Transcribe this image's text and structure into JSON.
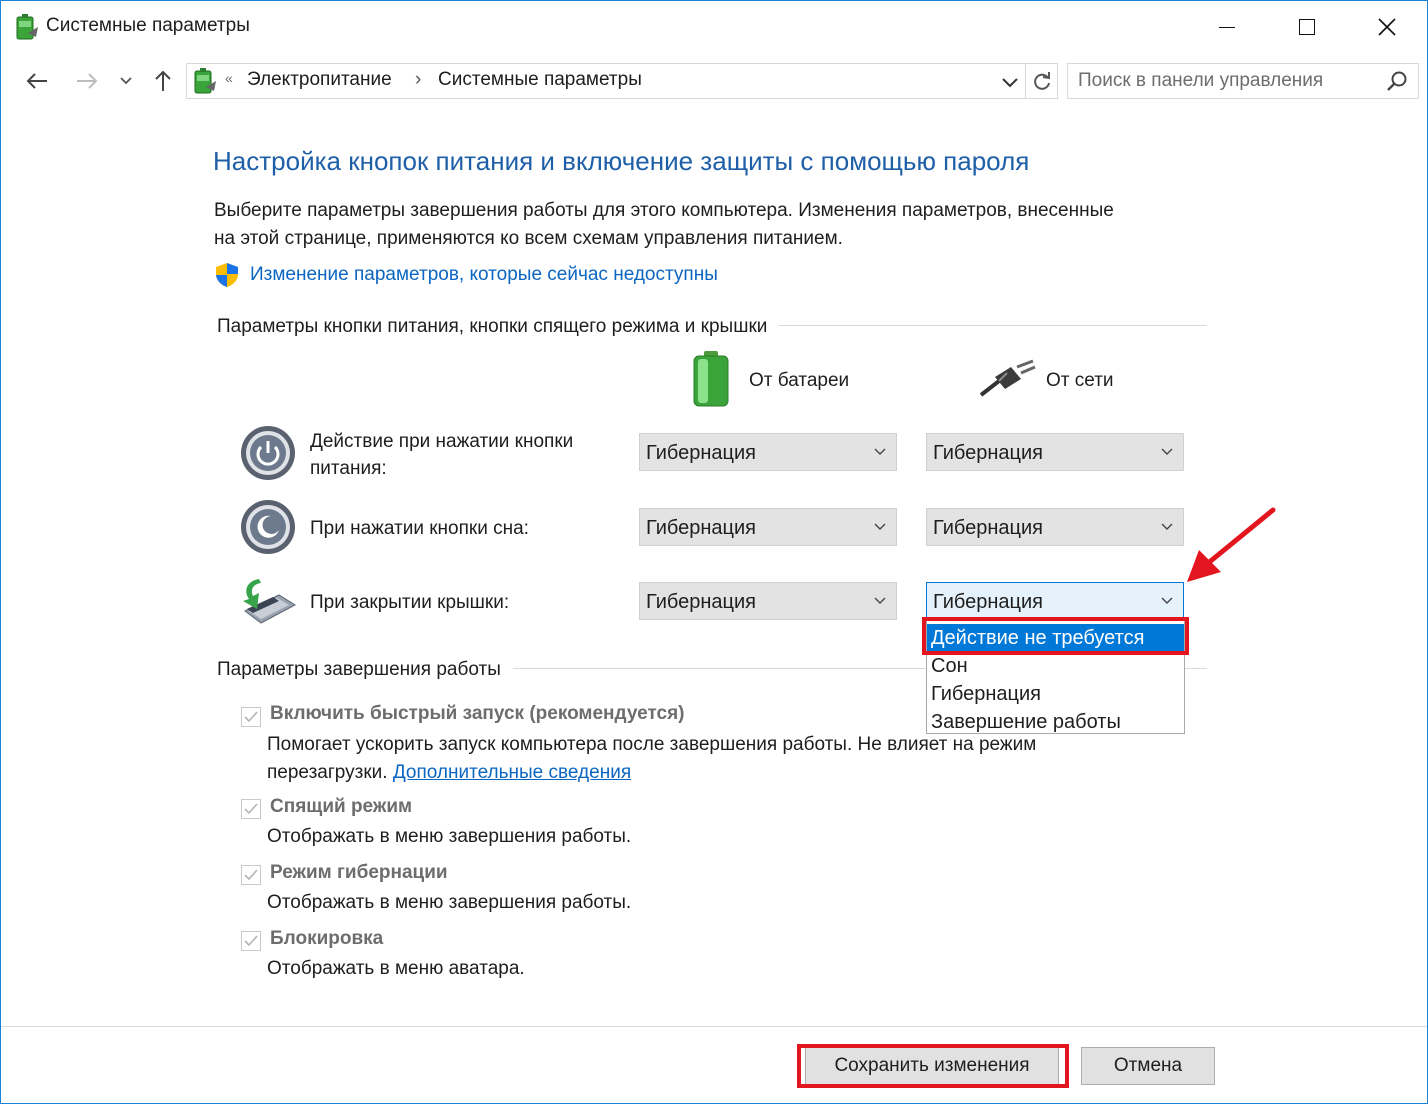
{
  "window": {
    "title": "Системные параметры",
    "minimize_icon": "minimize-icon",
    "maximize_icon": "maximize-icon",
    "close_icon": "close-icon"
  },
  "address_bar": {
    "breadcrumb": [
      "«",
      "Электропитание",
      "›",
      "Системные параметры"
    ],
    "search_placeholder": "Поиск в панели управления"
  },
  "page": {
    "title": "Настройка кнопок питания и включение защиты с помощью пароля",
    "description_line1": "Выберите параметры завершения работы для этого компьютера. Изменения параметров, внесенные",
    "description_line2": "на этой странице, применяются ко всем схемам управления питанием.",
    "admin_link": "Изменение параметров, которые сейчас недоступны"
  },
  "power_buttons": {
    "section_title": "Параметры кнопки питания, кнопки спящего режима и крышки",
    "column_battery": "От батареи",
    "column_ac": "От сети",
    "rows": [
      {
        "label_line1": "Действие при нажатии кнопки",
        "label_line2": "питания:",
        "battery": "Гибернация",
        "ac": "Гибернация"
      },
      {
        "label_line1": "При нажатии кнопки сна:",
        "battery": "Гибернация",
        "ac": "Гибернация"
      },
      {
        "label_line1": "При закрытии крышки:",
        "battery": "Гибернация",
        "ac": "Гибернация"
      }
    ],
    "dropdown_options": [
      "Действие не требуется",
      "Сон",
      "Гибернация",
      "Завершение работы"
    ],
    "dropdown_highlighted": "Действие не требуется"
  },
  "shutdown": {
    "section_title": "Параметры завершения работы",
    "items": [
      {
        "title": "Включить быстрый запуск (рекомендуется)",
        "desc1": "Помогает ускорить запуск компьютера после завершения работы. Не влияет на режим",
        "desc2": "перезагрузки. ",
        "link": "Дополнительные сведения",
        "checked": true
      },
      {
        "title": "Спящий режим",
        "desc1": "Отображать в меню завершения работы.",
        "checked": true
      },
      {
        "title": "Режим гибернации",
        "desc1": "Отображать в меню завершения работы.",
        "checked": true
      },
      {
        "title": "Блокировка",
        "desc1": "Отображать в меню аватара.",
        "checked": true
      }
    ]
  },
  "footer": {
    "save_label": "Сохранить изменения",
    "cancel_label": "Отмена"
  },
  "colors": {
    "accent": "#0078d7",
    "title_blue": "#1e5fa8",
    "link": "#0b66c2",
    "annotation_red": "#e3151e"
  }
}
